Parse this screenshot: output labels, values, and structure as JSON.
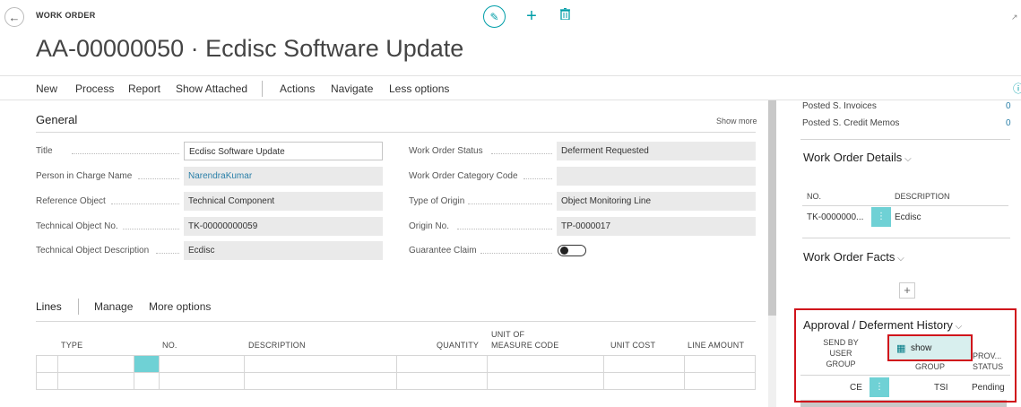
{
  "header": {
    "back_icon": "back-arrow-icon",
    "caption": "WORK ORDER",
    "title": "AA-00000050 · Ecdisc Software Update",
    "edit_icon": "pencil-icon",
    "add_icon": "plus-icon",
    "delete_icon": "trash-icon",
    "expand_icon": "expand-icon"
  },
  "actions": [
    "New",
    "Process",
    "Report",
    "Show Attached",
    "Actions",
    "Navigate",
    "Less options"
  ],
  "general": {
    "heading": "General",
    "show_more": "Show more",
    "left_fields": [
      {
        "label": "Title",
        "value": "Ecdisc Software Update"
      },
      {
        "label": "Person in Charge Name",
        "value": "NarendraKumar"
      },
      {
        "label": "Reference Object",
        "value": "Technical Component"
      },
      {
        "label": "Technical Object No.",
        "value": "TK-00000000059"
      },
      {
        "label": "Technical Object Description",
        "value": "Ecdisc"
      }
    ],
    "right_fields": [
      {
        "label": "Work Order Status",
        "value": "Deferment Requested"
      },
      {
        "label": "Work Order Category Code",
        "value": ""
      },
      {
        "label": "Type of Origin",
        "value": "Object Monitoring Line"
      },
      {
        "label": "Origin No.",
        "value": "TP-0000017"
      },
      {
        "label": "Guarantee Claim",
        "value": ""
      }
    ]
  },
  "lines": {
    "heading": "Lines",
    "actions": [
      "Manage",
      "More options"
    ],
    "columns": [
      "TYPE",
      "NO.",
      "DESCRIPTION",
      "QUANTITY",
      "UNIT OF\nMEASURE CODE",
      "UNIT COST",
      "LINE AMOUNT"
    ]
  },
  "factbox": {
    "posted_rows": [
      {
        "label": "Posted S. Invoices",
        "value": "0"
      },
      {
        "label": "Posted S. Credit Memos",
        "value": "0"
      }
    ],
    "details_title": "Work Order Details",
    "details_columns": [
      "NO.",
      "DESCRIPTION"
    ],
    "details_row": {
      "no": "TK-0000000...",
      "description": "Ecdisc"
    },
    "facts_title": "Work Order Facts",
    "history_title": "Approval / Deferment History",
    "history_columns": [
      "SEND BY\nUSER\nGROUP",
      "GROUP",
      "PROV...\nSTATUS"
    ],
    "history_row": {
      "send_by": "CE",
      "group": "TSI",
      "status": "Pending"
    },
    "popup_label": "show",
    "chevron_icon": "chevron-down-icon"
  },
  "colors": {
    "accent": "#009ea8",
    "teal_cell": "#6fd1d5",
    "highlight": "#d0131b"
  }
}
